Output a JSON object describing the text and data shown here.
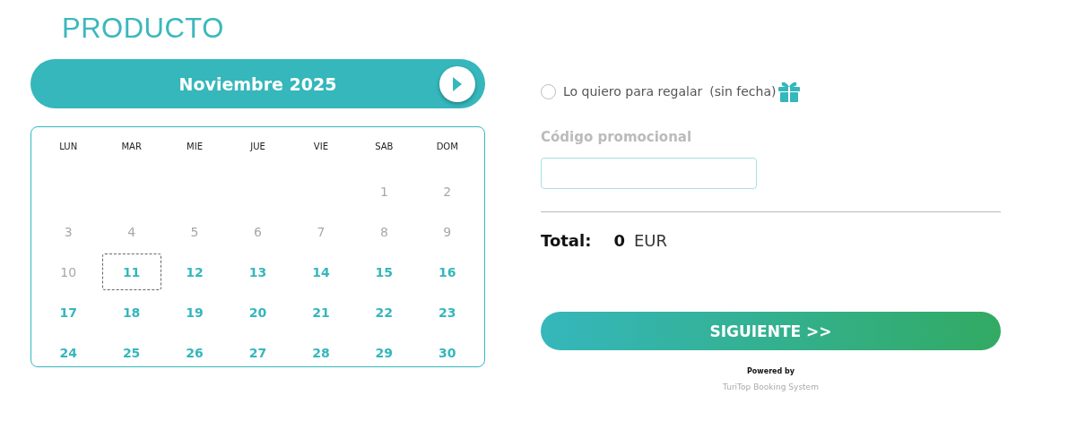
{
  "title": "PRODUCTO",
  "calendar": {
    "month": "Noviembre 2025",
    "weekdays": [
      "LUN",
      "MAR",
      "MIE",
      "JUE",
      "VIE",
      "SAB",
      "DOM"
    ],
    "weeks": [
      [
        {
          "kind": "empty"
        },
        {
          "kind": "empty"
        },
        {
          "kind": "empty"
        },
        {
          "kind": "empty"
        },
        {
          "kind": "empty"
        },
        {
          "kind": "day",
          "label": "1",
          "available": false,
          "focused": false
        },
        {
          "kind": "day",
          "label": "2",
          "available": false,
          "focused": false
        }
      ],
      [
        {
          "kind": "day",
          "label": "3",
          "available": false,
          "focused": false
        },
        {
          "kind": "day",
          "label": "4",
          "available": false,
          "focused": false
        },
        {
          "kind": "day",
          "label": "5",
          "available": false,
          "focused": false
        },
        {
          "kind": "day",
          "label": "6",
          "available": false,
          "focused": false
        },
        {
          "kind": "day",
          "label": "7",
          "available": false,
          "focused": false
        },
        {
          "kind": "day",
          "label": "8",
          "available": false,
          "focused": false
        },
        {
          "kind": "day",
          "label": "9",
          "available": false,
          "focused": false
        }
      ],
      [
        {
          "kind": "day",
          "label": "10",
          "available": false,
          "focused": false
        },
        {
          "kind": "day",
          "label": "11",
          "available": true,
          "focused": true
        },
        {
          "kind": "day",
          "label": "12",
          "available": true,
          "focused": false
        },
        {
          "kind": "day",
          "label": "13",
          "available": true,
          "focused": false
        },
        {
          "kind": "day",
          "label": "14",
          "available": true,
          "focused": false
        },
        {
          "kind": "day",
          "label": "15",
          "available": true,
          "focused": false
        },
        {
          "kind": "day",
          "label": "16",
          "available": true,
          "focused": false
        }
      ],
      [
        {
          "kind": "day",
          "label": "17",
          "available": true,
          "focused": false
        },
        {
          "kind": "day",
          "label": "18",
          "available": true,
          "focused": false
        },
        {
          "kind": "day",
          "label": "19",
          "available": true,
          "focused": false
        },
        {
          "kind": "day",
          "label": "20",
          "available": true,
          "focused": false
        },
        {
          "kind": "day",
          "label": "21",
          "available": true,
          "focused": false
        },
        {
          "kind": "day",
          "label": "22",
          "available": true,
          "focused": false
        },
        {
          "kind": "day",
          "label": "23",
          "available": true,
          "focused": false
        }
      ],
      [
        {
          "kind": "day",
          "label": "24",
          "available": true,
          "focused": false
        },
        {
          "kind": "day",
          "label": "25",
          "available": true,
          "focused": false
        },
        {
          "kind": "day",
          "label": "26",
          "available": true,
          "focused": false
        },
        {
          "kind": "day",
          "label": "27",
          "available": true,
          "focused": false
        },
        {
          "kind": "day",
          "label": "28",
          "available": true,
          "focused": false
        },
        {
          "kind": "day",
          "label": "29",
          "available": true,
          "focused": false
        },
        {
          "kind": "day",
          "label": "30",
          "available": true,
          "focused": false
        }
      ]
    ]
  },
  "gift": {
    "label": "Lo quiero para regalar",
    "note": "(sin fecha)",
    "checked": false
  },
  "promo": {
    "label": "Código promocional"
  },
  "total": {
    "label": "Total:",
    "amount": "0",
    "currency": "EUR"
  },
  "next_button": "SIGUIENTE >>",
  "footer": {
    "powered": "Powered by",
    "brand": "TuriTop Booking System"
  }
}
